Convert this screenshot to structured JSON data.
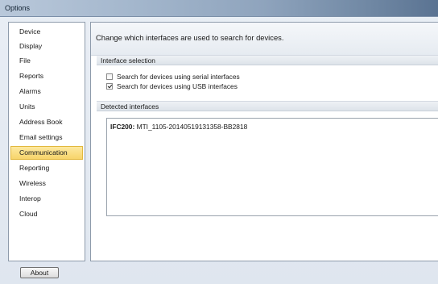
{
  "window": {
    "title": "Options"
  },
  "sidebar": {
    "items": [
      {
        "label": "Device"
      },
      {
        "label": "Display"
      },
      {
        "label": "File"
      },
      {
        "label": "Reports"
      },
      {
        "label": "Alarms"
      },
      {
        "label": "Units"
      },
      {
        "label": "Address Book"
      },
      {
        "label": "Email settings"
      },
      {
        "label": "Communication",
        "selected": true
      },
      {
        "label": "Reporting"
      },
      {
        "label": "Wireless"
      },
      {
        "label": "Interop"
      },
      {
        "label": "Cloud"
      }
    ]
  },
  "main": {
    "header": "Change which interfaces are used to search for devices.",
    "interface_selection": {
      "title": "Interface selection",
      "options": [
        {
          "label": "Search for devices using serial interfaces",
          "checked": false
        },
        {
          "label": "Search for devices using USB interfaces",
          "checked": true
        }
      ]
    },
    "detected": {
      "title": "Detected interfaces",
      "entries": [
        {
          "name": "IFC200:",
          "detail": "MTI_1105-20140519131358-BB2818"
        }
      ]
    }
  },
  "footer": {
    "about_label": "About"
  },
  "colors": {
    "selected_item": "#f7d46a",
    "selected_border": "#e2b83e"
  }
}
